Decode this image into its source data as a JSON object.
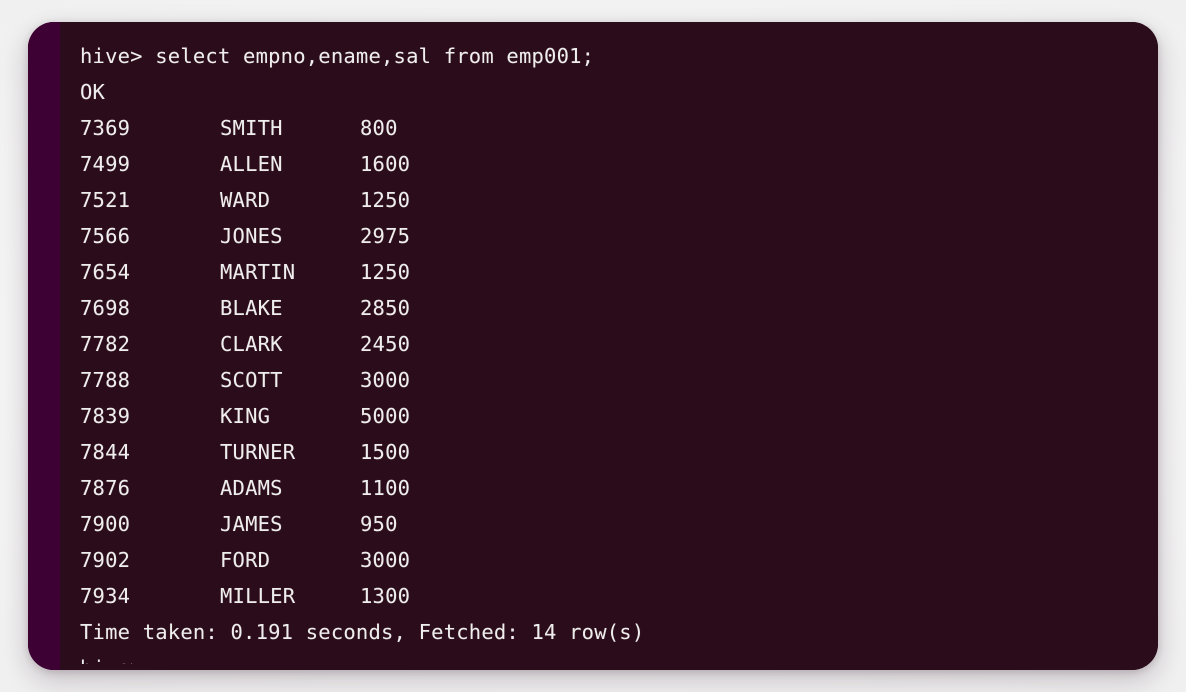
{
  "window": {
    "kind": "terminal-window",
    "background_color": "#2a0c1b",
    "scrollbar_color": "#3a0030",
    "page_background_color": "#f2f2f2",
    "text_color": "#eeeeee"
  },
  "terminal": {
    "prompt_line": "hive> select empno,ename,sal from emp001;",
    "status_ok": "OK",
    "columns": [
      "empno",
      "ename",
      "sal"
    ],
    "rows": [
      {
        "empno": "7369",
        "ename": "SMITH",
        "sal": "800"
      },
      {
        "empno": "7499",
        "ename": "ALLEN",
        "sal": "1600"
      },
      {
        "empno": "7521",
        "ename": "WARD",
        "sal": "1250"
      },
      {
        "empno": "7566",
        "ename": "JONES",
        "sal": "2975"
      },
      {
        "empno": "7654",
        "ename": "MARTIN",
        "sal": "1250"
      },
      {
        "empno": "7698",
        "ename": "BLAKE",
        "sal": "2850"
      },
      {
        "empno": "7782",
        "ename": "CLARK",
        "sal": "2450"
      },
      {
        "empno": "7788",
        "ename": "SCOTT",
        "sal": "3000"
      },
      {
        "empno": "7839",
        "ename": "KING",
        "sal": "5000"
      },
      {
        "empno": "7844",
        "ename": "TURNER",
        "sal": "1500"
      },
      {
        "empno": "7876",
        "ename": "ADAMS",
        "sal": "1100"
      },
      {
        "empno": "7900",
        "ename": "JAMES",
        "sal": "950"
      },
      {
        "empno": "7902",
        "ename": "FORD",
        "sal": "3000"
      },
      {
        "empno": "7934",
        "ename": "MILLER",
        "sal": "1300"
      }
    ],
    "time_taken_line": "Time taken: 0.191 seconds, Fetched: 14 row(s)",
    "next_prompt_partial": "hive>"
  }
}
